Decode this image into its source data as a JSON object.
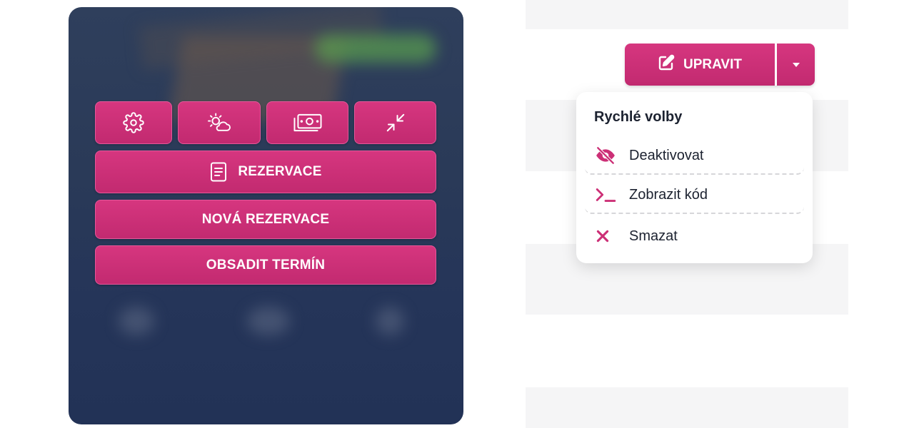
{
  "card": {
    "icon_buttons": [
      {
        "name": "settings-button",
        "icon": "gear-icon"
      },
      {
        "name": "weather-button",
        "icon": "sun-cloud-icon"
      },
      {
        "name": "payment-button",
        "icon": "money-icon"
      },
      {
        "name": "collapse-button",
        "icon": "collapse-arrows-icon"
      }
    ],
    "reservations_label": "REZERVACE",
    "new_reservation_label": "NOVÁ REZERVACE",
    "book_slot_label": "OBSADIT TERMÍN"
  },
  "edit_menu": {
    "edit_label": "UPRAVIT",
    "menu_title": "Rychlé volby",
    "items": [
      {
        "label": "Deaktivovat",
        "icon": "eye-off-icon"
      },
      {
        "label": "Zobrazit kód",
        "icon": "terminal-icon"
      },
      {
        "label": "Smazat",
        "icon": "close-icon"
      }
    ]
  },
  "colors": {
    "accent": "#cc2f76",
    "card_background": "#2a3a58",
    "text_dark": "#1c2230"
  }
}
